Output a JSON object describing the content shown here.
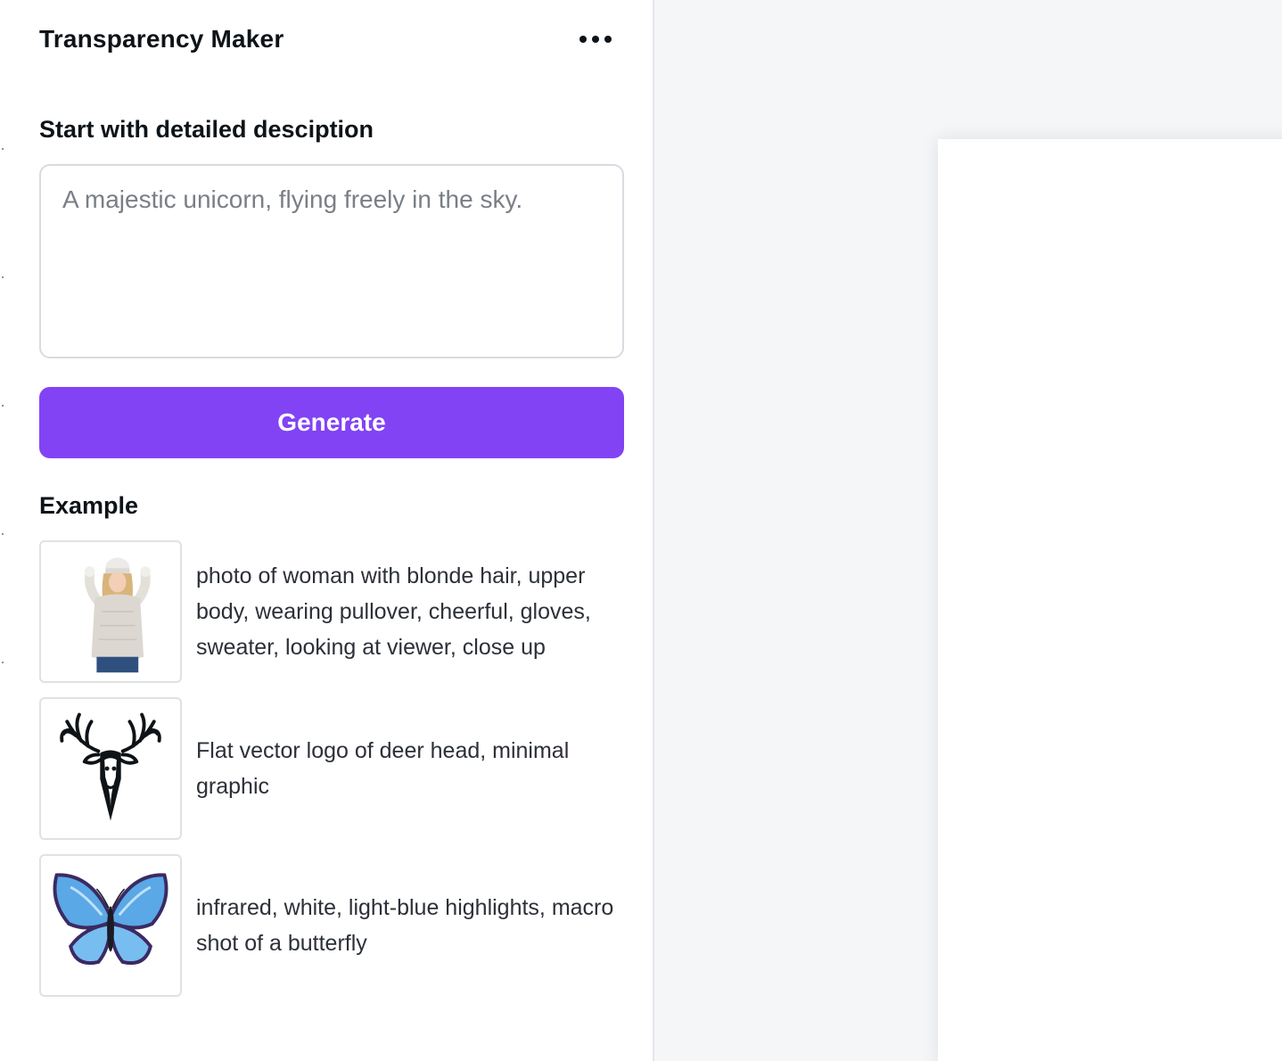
{
  "app": {
    "title": "Transparency Maker",
    "more_icon": "more-horizontal-icon"
  },
  "prompt": {
    "label": "Start with detailed desciption",
    "placeholder": "A majestic unicorn, flying freely in the sky.",
    "value": ""
  },
  "generate": {
    "label": "Generate",
    "color": "#8243f5"
  },
  "examples": {
    "label": "Example",
    "items": [
      {
        "text": "photo of woman with blonde hair, upper body, wearing pullover, cheerful, gloves, sweater, looking at viewer, close up",
        "thumbnail": "woman-photo-thumbnail"
      },
      {
        "text": "Flat vector logo of deer head, minimal graphic",
        "thumbnail": "deer-logo-thumbnail"
      },
      {
        "text": "infrared, white, light-blue highlights, macro shot of a butterfly",
        "thumbnail": "butterfly-thumbnail"
      }
    ]
  },
  "colors": {
    "accent": "#8243f5",
    "canvas_background": "#f5f6f8",
    "text_primary": "#0e1318"
  }
}
